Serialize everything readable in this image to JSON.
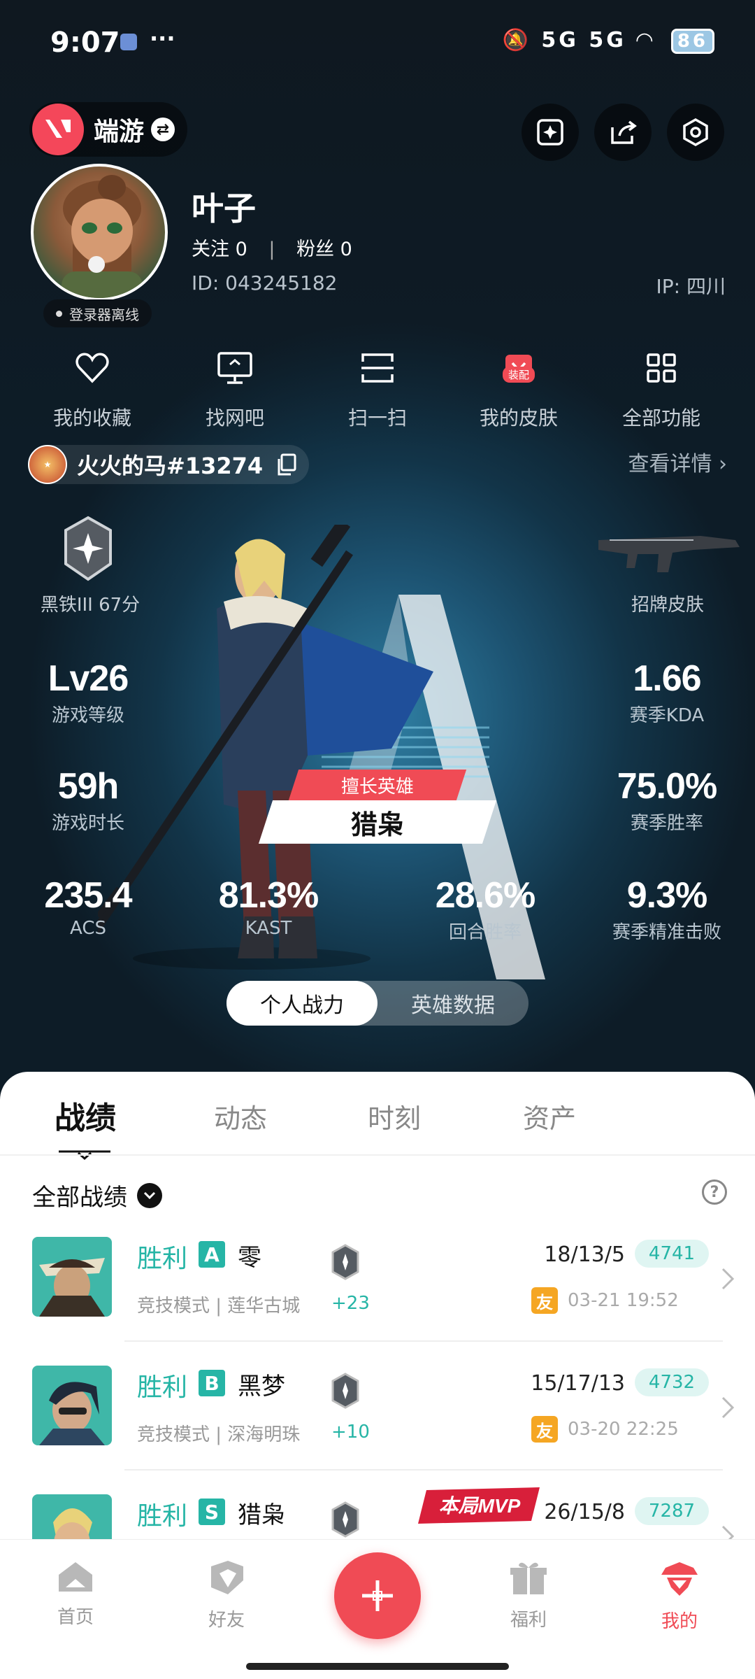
{
  "status_bar": {
    "time": "9:07",
    "network": "5G 5G",
    "battery": "86"
  },
  "header": {
    "game_name": "端游"
  },
  "profile": {
    "name": "叶子",
    "follow": "关注 0",
    "fans": "粉丝 0",
    "id": "ID:  043245182",
    "ip": "IP:  四川",
    "status": "登录器离线"
  },
  "shortcuts": [
    {
      "label": "我的收藏",
      "icon": "heart-icon"
    },
    {
      "label": "找网吧",
      "icon": "monitor-icon"
    },
    {
      "label": "扫一扫",
      "icon": "scan-icon"
    },
    {
      "label": "我的皮肤",
      "icon": "skin-icon",
      "badge": "装配"
    },
    {
      "label": "全部功能",
      "icon": "grid-icon"
    }
  ],
  "account": {
    "name": "火火的马#13274",
    "view_details": "查看详情"
  },
  "stats": {
    "rank": {
      "label": "黑铁III 67分"
    },
    "skin": {
      "label": "招牌皮肤"
    },
    "level": {
      "value": "Lv26",
      "label": "游戏等级"
    },
    "kda": {
      "value": "1.66",
      "label": "赛季KDA"
    },
    "hours": {
      "value": "59h",
      "label": "游戏时长"
    },
    "winrate": {
      "value": "75.0%",
      "label": "赛季胜率"
    },
    "acs": {
      "value": "235.4",
      "label": "ACS"
    },
    "kast": {
      "value": "81.3%",
      "label": "KAST"
    },
    "round_win": {
      "value": "28.6%",
      "label": "回合胜率"
    },
    "headshot": {
      "value": "9.3%",
      "label": "赛季精准击败"
    }
  },
  "favorite_hero": {
    "tag": "擅长英雄",
    "name": "猎枭"
  },
  "toggle": {
    "left": "个人战力",
    "right": "英雄数据"
  },
  "tabs": [
    "战绩",
    "动态",
    "时刻",
    "资产"
  ],
  "filter": {
    "label": "全部战绩"
  },
  "matches": [
    {
      "result": "胜利",
      "rank": "A",
      "hero": "零",
      "mode": "竞技模式 | 莲华古城",
      "delta": "+23",
      "kda": "18/13/5",
      "score": "4741",
      "friend": "友",
      "date": "03-21 19:52"
    },
    {
      "result": "胜利",
      "rank": "B",
      "hero": "黑梦",
      "mode": "竞技模式 | 深海明珠",
      "delta": "+10",
      "kda": "15/17/13",
      "score": "4732",
      "friend": "友",
      "date": "03-20 22:25"
    },
    {
      "result": "胜利",
      "rank": "S",
      "hero": "猎枭",
      "mode": "",
      "delta": "",
      "kda": "26/15/8",
      "score": "7287",
      "mvp": "本局MVP"
    }
  ],
  "nav": [
    {
      "label": "首页",
      "icon": "home-icon"
    },
    {
      "label": "好友",
      "icon": "friends-icon"
    },
    {
      "label": "福利",
      "icon": "gift-icon"
    },
    {
      "label": "我的",
      "icon": "me-icon"
    }
  ]
}
